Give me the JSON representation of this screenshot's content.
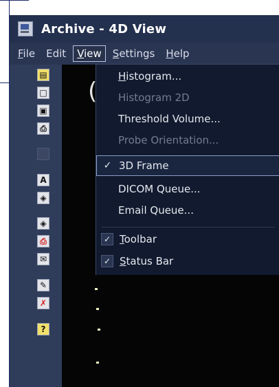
{
  "window": {
    "title": "Archive - 4D View"
  },
  "menubar": {
    "items": [
      {
        "label": "File",
        "underline": "F",
        "rest": "ile"
      },
      {
        "label": "Edit",
        "underline": "",
        "rest": "Edit"
      },
      {
        "label": "View",
        "underline": "V",
        "rest": "iew"
      },
      {
        "label": "Settings",
        "underline": "S",
        "rest": "ettings"
      },
      {
        "label": "Help",
        "underline": "H",
        "rest": "elp"
      }
    ],
    "active": "View"
  },
  "view_menu": {
    "items": [
      {
        "label": "Histogram...",
        "underline": "H",
        "rest": "istogram...",
        "enabled": true,
        "checked": false
      },
      {
        "label": "Histogram 2D",
        "enabled": false,
        "checked": false
      },
      {
        "label": "Threshold Volume...",
        "enabled": true,
        "checked": false
      },
      {
        "label": "Probe Orientation...",
        "enabled": false,
        "checked": false
      },
      {
        "label": "3D Frame",
        "enabled": true,
        "checked": true
      },
      {
        "label": "DICOM Queue...",
        "enabled": true,
        "checked": false
      },
      {
        "label": "Email Queue...",
        "enabled": true,
        "checked": false
      },
      {
        "label": "Toolbar",
        "underline": "T",
        "rest": "oolbar",
        "enabled": true,
        "checked": true
      },
      {
        "label": "Status Bar",
        "underline": "S",
        "rest": "tatus Bar",
        "enabled": true,
        "checked": true
      }
    ],
    "check_glyph": "✓"
  },
  "toolbar": {
    "buttons": [
      {
        "icon": "open-folder-icon",
        "glyph": "▤"
      },
      {
        "icon": "new-document-icon",
        "glyph": "□"
      },
      {
        "icon": "save-disk-icon",
        "glyph": "▣"
      },
      {
        "icon": "print-icon",
        "glyph": "⎙"
      },
      {
        "icon": "disabled-tool-icon",
        "glyph": ""
      },
      {
        "icon": "text-annotation-icon",
        "glyph": "A"
      },
      {
        "icon": "diamond-arrow-icon",
        "glyph": "◈"
      },
      {
        "icon": "diamond-arrow-2-icon",
        "glyph": "◈"
      },
      {
        "icon": "print-red-icon",
        "glyph": "⎙"
      },
      {
        "icon": "email-icon",
        "glyph": "✉"
      },
      {
        "icon": "edit-document-icon",
        "glyph": "✎"
      },
      {
        "icon": "delete-document-icon",
        "glyph": "✗"
      },
      {
        "icon": "help-icon",
        "glyph": "?"
      }
    ]
  },
  "viewport": {
    "partial_label": "("
  }
}
